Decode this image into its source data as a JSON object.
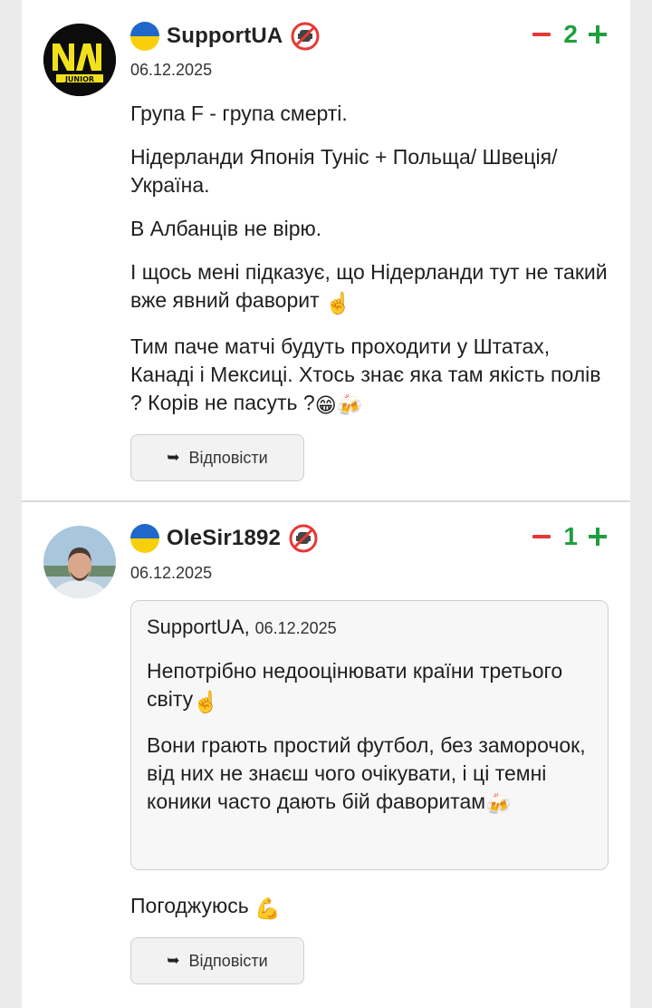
{
  "comments": [
    {
      "username": "SupportUA",
      "date": "06.12.2025",
      "vote_count": "2",
      "paragraphs": [
        "Група F - група смерті.",
        "Нідерланди Японія Туніс + Польща/ Швеція/Україна.",
        "В Албанців не вірю.",
        "І щось мені підказує, що Нідерланди тут не такий вже явний фаворит",
        "Тим паче матчі будуть проходити у Штатах, Канаді і Мексиці. Хтось знає яка там якість полів ? Корів не пасуть ?"
      ],
      "reply_label": "Відповісти",
      "avatar_logo_text": "NAVI JUNIOR"
    },
    {
      "username": "OleSir1892",
      "date": "06.12.2025",
      "vote_count": "1",
      "quote": {
        "author": "SupportUA,",
        "date": "06.12.2025",
        "paragraphs": [
          "Непотрібно недооцінювати країни третього світу",
          "Вони грають простий футбол, без заморочок, від них не знаєш чого очікувати, і ці темні коники часто дають бій фаворитам"
        ]
      },
      "text": "Погоджуюсь",
      "reply_label": "Відповісти"
    }
  ],
  "icons": {
    "flag": "ukraine-flag-icon",
    "badge": "no-mic-badge-icon",
    "reply": "reply-arrow-icon",
    "finger": "index-pointing-up-emoji",
    "grin": "grinning-emoji",
    "beers": "clinking-beers-emoji",
    "muscle": "flexed-biceps-emoji"
  },
  "colors": {
    "minus": "#e53935",
    "plus": "#1e9e3e",
    "flag_blue": "#1f67c9",
    "flag_yellow": "#f8cf0a"
  }
}
